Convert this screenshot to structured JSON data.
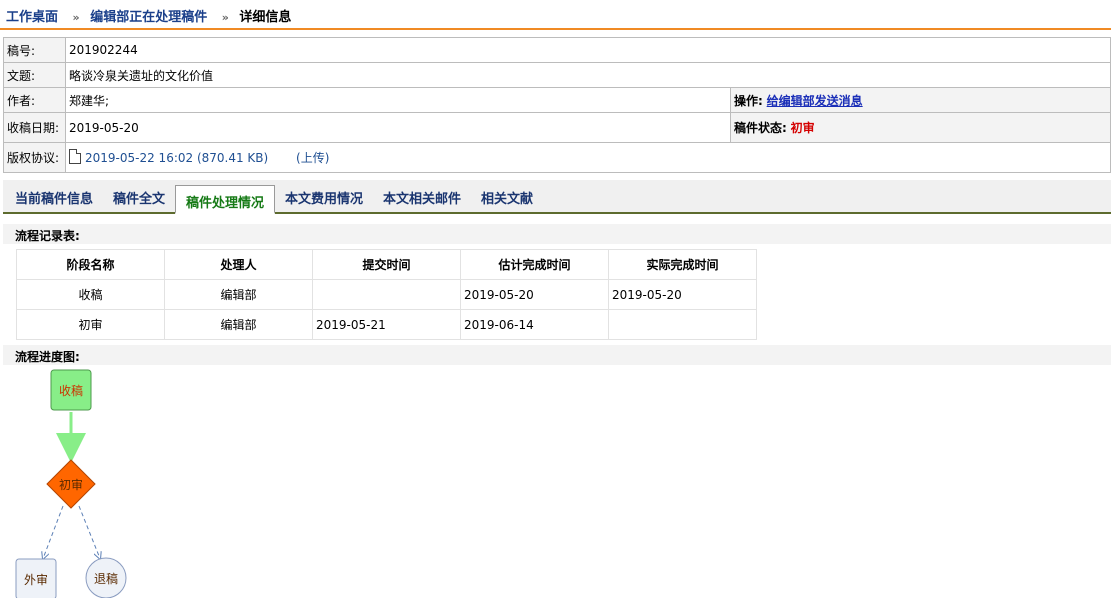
{
  "breadcrumb": {
    "items": [
      "工作桌面",
      "编辑部正在处理稿件",
      "详细信息"
    ],
    "separator": "»"
  },
  "manuscript": {
    "id_label": "稿号:",
    "id_value": "201902244",
    "title_label": "文题:",
    "title_value": "略谈冷泉关遗址的文化价值",
    "author_label": "作者:",
    "author_value": "郑建华;",
    "action_label": "操作:",
    "action_link": "给编辑部发送消息",
    "received_label": "收稿日期:",
    "received_value": "2019-05-20",
    "status_label": "稿件状态:",
    "status_value": "初审",
    "copyright_label": "版权协议:",
    "copyright_file": "2019-05-22 16:02 (870.41 KB)",
    "upload_label": "(上传)"
  },
  "tabs": [
    {
      "label": "当前稿件信息"
    },
    {
      "label": "稿件全文"
    },
    {
      "label": "稿件处理情况",
      "active": true
    },
    {
      "label": "本文费用情况"
    },
    {
      "label": "本文相关邮件"
    },
    {
      "label": "相关文献"
    }
  ],
  "flow_records": {
    "title": "流程记录表:",
    "headers": [
      "阶段名称",
      "处理人",
      "提交时间",
      "估计完成时间",
      "实际完成时间"
    ],
    "rows": [
      [
        "收稿",
        "编辑部",
        "",
        "2019-05-20",
        "2019-05-20"
      ],
      [
        "初审",
        "编辑部",
        "2019-05-21",
        "2019-06-14",
        ""
      ]
    ]
  },
  "flow_chart": {
    "title": "流程进度图:",
    "nodes": {
      "received": "收稿",
      "initial_review": "初审",
      "external_review": "外审",
      "rejected": "退稿"
    },
    "colors": {
      "received_fill": "#88ee88",
      "initial_review_fill": "#ff6600",
      "arrow_done": "#88ee88",
      "arrow_pending": "#5b7fb5"
    }
  },
  "colors": {
    "accent_orange": "#f08a24",
    "link_blue": "#1a3f8a",
    "active_tab_green": "#167a16",
    "status_red": "#d40000"
  }
}
